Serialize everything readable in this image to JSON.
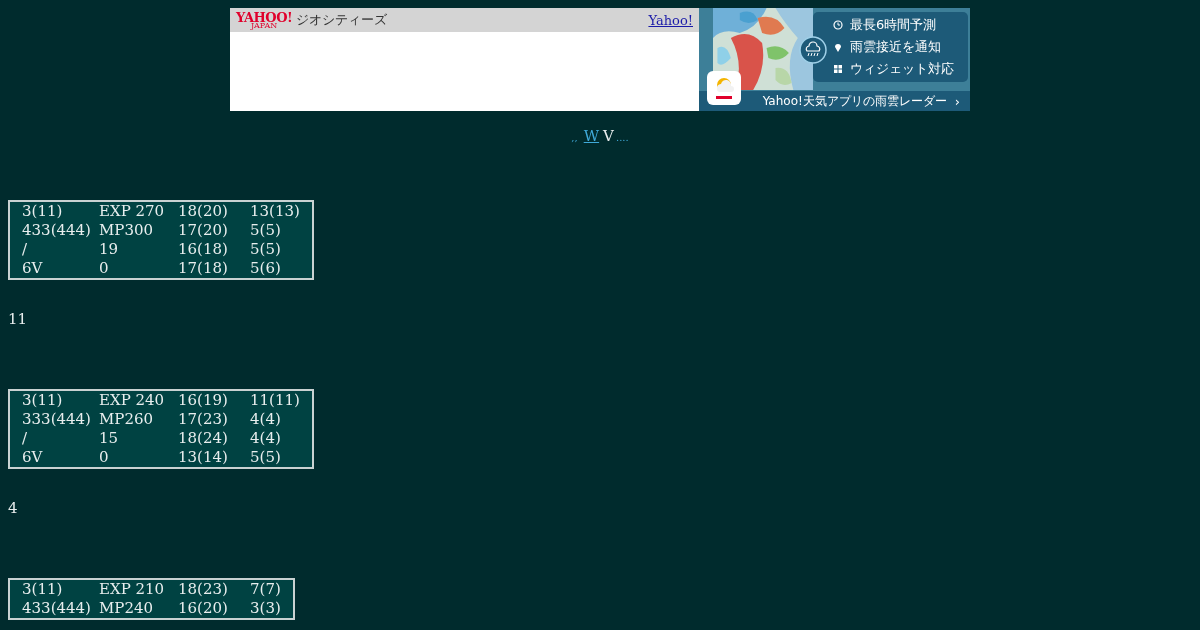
{
  "ad": {
    "brand": "YAHOO!",
    "brand_sub": "JAPAN",
    "service": "ジオシティーズ",
    "link": "Yahoo!",
    "features": [
      {
        "kind": "clock",
        "text": "最長6時間予測"
      },
      {
        "kind": "pin",
        "text": "雨雲接近を通知"
      },
      {
        "kind": "widget",
        "text": "ウィジェット対応"
      }
    ],
    "app_title": "Yahoo!天気アプリの雨雲レーダー",
    "arrow": "›"
  },
  "nav": [
    {
      "kind": "dots",
      "text": ",,"
    },
    {
      "kind": "link",
      "text": "W"
    },
    {
      "kind": "plain",
      "text": "V"
    },
    {
      "kind": "dots",
      "text": "...."
    }
  ],
  "sections": [
    {
      "rows": [
        [
          "3(11)",
          "EXP 270",
          "18(20)",
          "13(13)"
        ],
        [
          "433(444)",
          "MP300",
          "17(20)",
          "5(5)"
        ],
        [
          "/",
          "19",
          "16(18)",
          "5(5)"
        ],
        [
          "6V",
          "0",
          "17(18)",
          "5(6)"
        ]
      ],
      "note": "11"
    },
    {
      "rows": [
        [
          "3(11)",
          "EXP 240",
          "16(19)",
          "11(11)"
        ],
        [
          "333(444)",
          "MP260",
          "17(23)",
          "4(4)"
        ],
        [
          "/",
          "15",
          "18(24)",
          "4(4)"
        ],
        [
          "6V",
          "0",
          "13(14)",
          "5(5)"
        ]
      ],
      "note": "4"
    },
    {
      "rows": [
        [
          "3(11)",
          "EXP 210",
          "18(23)",
          "7(7)"
        ],
        [
          "433(444)",
          "MP240",
          "16(20)",
          "3(3)"
        ]
      ]
    }
  ]
}
